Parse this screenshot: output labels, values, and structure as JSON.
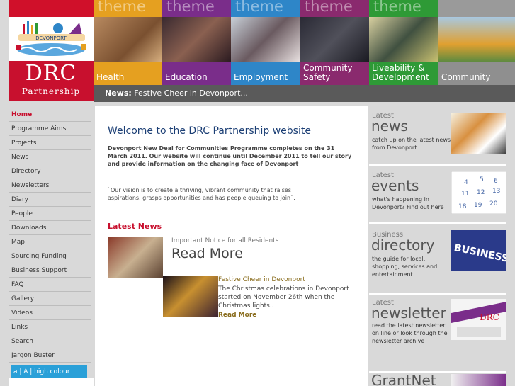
{
  "logo": {
    "brand": "DRC",
    "sub": "Partnership",
    "art_text": "DEVONPORT"
  },
  "themes": [
    {
      "word": "theme",
      "label": "Health",
      "color": "#e5a020"
    },
    {
      "word": "theme",
      "label": "Education",
      "color": "#7a2d8a"
    },
    {
      "word": "theme",
      "label": "Employment",
      "color": "#2e86c8"
    },
    {
      "word": "theme",
      "label": "Community Safety",
      "color": "#8a2a6e"
    },
    {
      "word": "theme",
      "label": "Liveability & Development",
      "color": "#2e9a36"
    },
    {
      "word": "",
      "label": "Community",
      "color": "#8f8f8f"
    }
  ],
  "ticker": {
    "label": "News:",
    "text": "Festive Cheer in Devonport..."
  },
  "nav": [
    "Home",
    "Programme Aims",
    "Projects",
    "News",
    "Directory",
    "Newsletters",
    "Diary",
    "People",
    "Downloads",
    "Map",
    "Sourcing Funding",
    "Business Support",
    "FAQ",
    "Gallery",
    "Videos",
    "Links",
    "Search",
    "Jargon Buster"
  ],
  "accessibility": "a | A | high colour",
  "main": {
    "welcome": "Welcome to the DRC Partnership website",
    "intro": "Devonport New Deal for Communities Programme completes on the 31 March 2011. Our website will continue until December 2011 to tell our story and provide information on the changing face of Devonport",
    "vision": "`Our vision is to create a thriving, vibrant community that raises aspirations, grasps opportunities and has people queuing to join`.",
    "latest_heading": "Latest News",
    "news": [
      {
        "title": "Important Notice for all Residents",
        "more": "Read More"
      },
      {
        "title": "Festive Cheer in Devonport",
        "text": "The Christmas celebrations in Devonport started on November 26th when the Christmas lights..",
        "more": "Read More"
      }
    ]
  },
  "right": [
    {
      "small": "Latest",
      "big": "news",
      "desc": "catch up on the latest news from Devonport"
    },
    {
      "small": "Latest",
      "big": "events",
      "desc": "what's happening in Devonport? Find out here"
    },
    {
      "small": "Business",
      "big": "directory",
      "desc": "the guide for local, shopping, services and entertainment",
      "img_text": "BUSINESS DIRECT"
    },
    {
      "small": "Latest",
      "big": "newsletter",
      "desc": "read the latest newsletter on line or look through the newsletter archive",
      "img_text": "DRC"
    },
    {
      "small": "",
      "big": "GrantNet",
      "desc": ""
    }
  ]
}
